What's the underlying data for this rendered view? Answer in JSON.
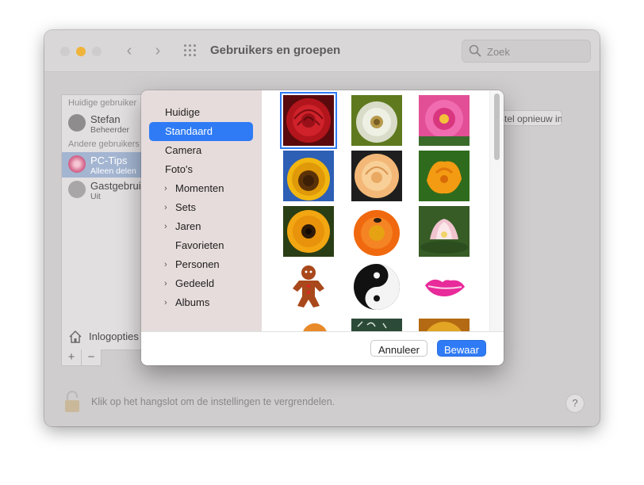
{
  "window": {
    "title": "Gebruikers en groepen",
    "search_placeholder": "Zoek"
  },
  "users": {
    "current_header": "Huidige gebruiker",
    "other_header": "Andere gebruikers",
    "items": [
      {
        "name": "Stefan",
        "role": "Beheerder"
      },
      {
        "name": "PC-Tips",
        "role": "Alleen delen"
      },
      {
        "name": "Gastgebruiker",
        "role": "Uit"
      }
    ],
    "login_options": "Inlogopties",
    "plus": "+",
    "minus": "−"
  },
  "restore_button": "Stel opnieuw in...",
  "lock_text": "Klik op het hangslot om de instellingen te vergrendelen.",
  "help": "?",
  "sheet": {
    "sidebar": [
      {
        "label": "Huidige",
        "chevron": false,
        "selected": false
      },
      {
        "label": "Standaard",
        "chevron": false,
        "selected": true
      },
      {
        "label": "Camera",
        "chevron": false,
        "selected": false
      },
      {
        "label": "Foto's",
        "chevron": false,
        "selected": false
      },
      {
        "label": "Momenten",
        "chevron": true,
        "selected": false
      },
      {
        "label": "Sets",
        "chevron": true,
        "selected": false
      },
      {
        "label": "Jaren",
        "chevron": true,
        "selected": false
      },
      {
        "label": "Favorieten",
        "chevron": false,
        "selected": false
      },
      {
        "label": "Personen",
        "chevron": true,
        "selected": false
      },
      {
        "label": "Gedeeld",
        "chevron": true,
        "selected": false
      },
      {
        "label": "Albums",
        "chevron": true,
        "selected": false
      }
    ],
    "cancel_label": "Annuleer",
    "save_label": "Bewaar"
  },
  "gallery": [
    {
      "name": "red-rose-picture"
    },
    {
      "name": "dandelion-picture"
    },
    {
      "name": "pink-dahlia-picture"
    },
    {
      "name": "sunflower-picture"
    },
    {
      "name": "peach-rose-picture"
    },
    {
      "name": "orange-poppy-picture"
    },
    {
      "name": "black-eyed-susan-picture"
    },
    {
      "name": "orange-gerbera-picture"
    },
    {
      "name": "lotus-picture"
    },
    {
      "name": "gingerbread-man-picture"
    },
    {
      "name": "yin-yang-picture"
    },
    {
      "name": "lips-picture"
    },
    {
      "name": "partial-picture-1"
    },
    {
      "name": "chalkboard-picture"
    },
    {
      "name": "golden-coin-picture"
    }
  ],
  "colors": {
    "accent": "#2f7bf5",
    "traffic_yellow": "#f0b43c",
    "sidebar_bg": "#e7dcdc"
  }
}
